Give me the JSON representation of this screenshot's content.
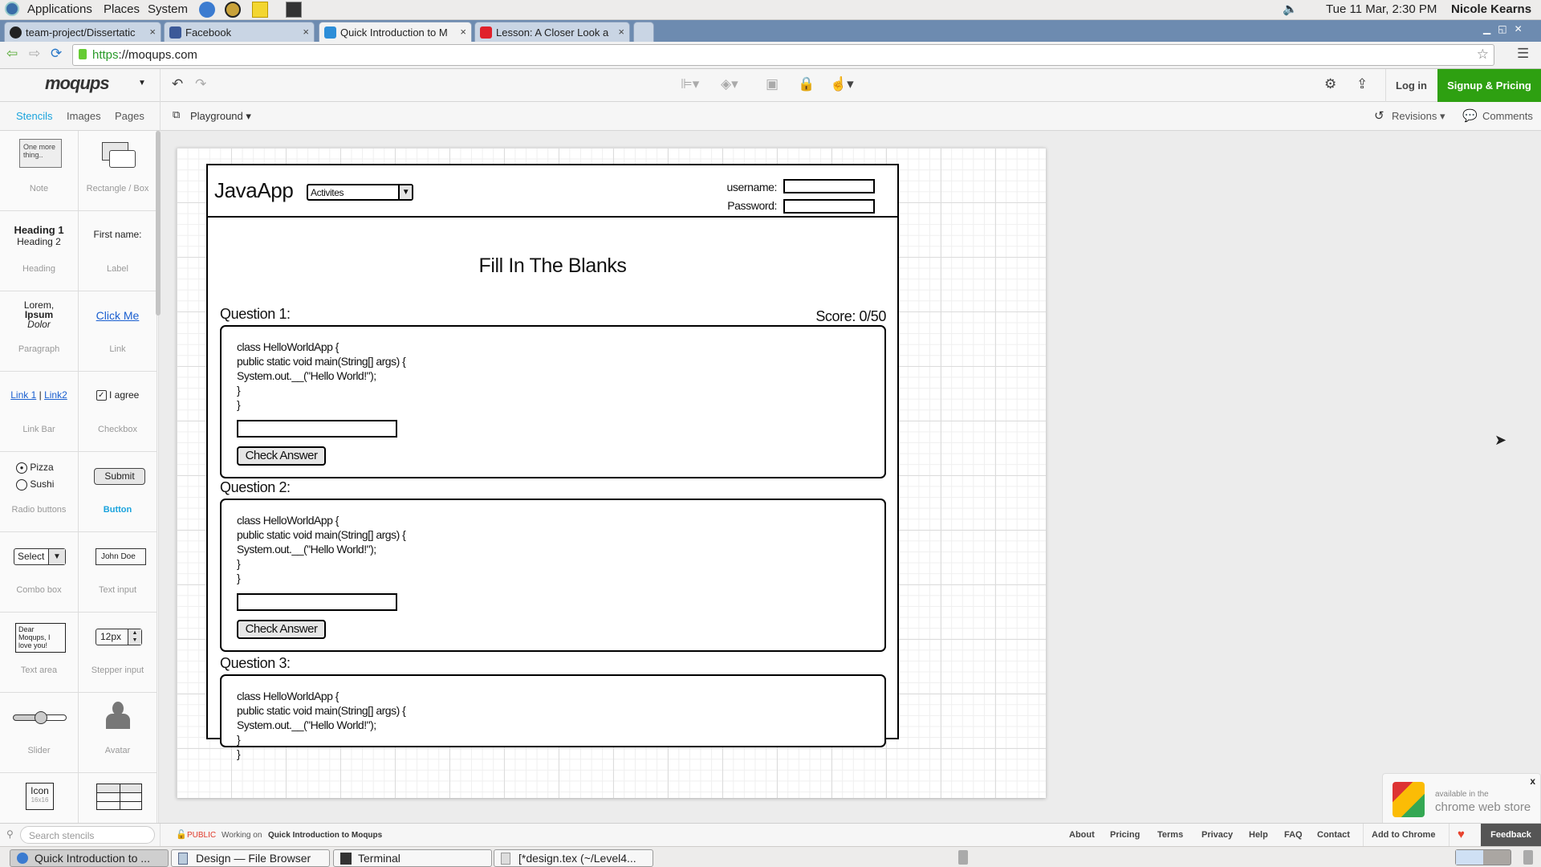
{
  "os_panel": {
    "menus": [
      "Applications",
      "Places",
      "System"
    ],
    "clock": "Tue 11 Mar,  2:30 PM",
    "user": "Nicole Kearns"
  },
  "browser": {
    "tabs": [
      {
        "title": "team-project/Dissertatic",
        "active": false
      },
      {
        "title": "Facebook",
        "active": false
      },
      {
        "title": "Quick Introduction to M",
        "active": true
      },
      {
        "title": "Lesson: A Closer Look a",
        "active": false
      }
    ],
    "url_scheme": "https",
    "url_rest": "://moqups.com"
  },
  "app": {
    "logo": "moqups",
    "login": "Log in",
    "signup": "Signup & Pricing",
    "side_tabs": [
      "Stencils",
      "Images",
      "Pages"
    ],
    "page_selector": "Playground",
    "revisions": "Revisions",
    "comments": "Comments",
    "search_placeholder": "Search stencils",
    "status": {
      "visibility": "PUBLIC",
      "working_on": "Working on",
      "project": "Quick Introduction to Moqups"
    },
    "footer_links": [
      "About",
      "Pricing",
      "Terms",
      "Privacy",
      "Help",
      "FAQ",
      "Contact",
      "Add to Chrome"
    ],
    "feedback": "Feedback",
    "chrome_store": {
      "line1": "available in the",
      "line2": "chrome web store"
    },
    "accent": "#1aa3dd",
    "signup_color": "#2ea011"
  },
  "stencils": {
    "note": {
      "label": "Note",
      "preview": "One more thing.."
    },
    "rect": {
      "label": "Rectangle / Box"
    },
    "heading": {
      "label": "Heading",
      "h1": "Heading 1",
      "h2": "Heading 2"
    },
    "label": {
      "label": "Label",
      "preview": "First name:"
    },
    "paragraph": {
      "label": "Paragraph",
      "l1": "Lorem,",
      "l2": "Ipsum",
      "l3": "Dolor"
    },
    "link": {
      "label": "Link",
      "preview": "Click Me"
    },
    "linkbar": {
      "label": "Link Bar",
      "l1": "Link 1",
      "sep": "|",
      "l2": "Link2"
    },
    "checkbox": {
      "label": "Checkbox",
      "preview": "I agree"
    },
    "radio": {
      "label": "Radio buttons",
      "o1": "Pizza",
      "o2": "Sushi"
    },
    "button": {
      "label": "Button",
      "preview": "Submit"
    },
    "combo": {
      "label": "Combo box",
      "preview": "Select"
    },
    "textinput": {
      "label": "Text input",
      "preview": "John Doe"
    },
    "textarea": {
      "label": "Text area",
      "preview": "Dear Moqups, I love you!"
    },
    "stepper": {
      "label": "Stepper input",
      "preview": "12px"
    },
    "slider": {
      "label": "Slider",
      "value": 0.55
    },
    "avatar": {
      "label": "Avatar"
    },
    "icon": {
      "preview": "Icon",
      "size": "16x16"
    }
  },
  "mockup": {
    "app_name": "JavaApp",
    "combo": "Activites",
    "username_label": "username:",
    "password_label": "Password:",
    "title": "Fill In The Blanks",
    "score": "Score: 0/50",
    "questions": [
      {
        "label": "Question 1:",
        "code": [
          "class HelloWorldApp {",
          "public static void main(String[] args) {",
          "System.out.__(\"Hello World!\");",
          "}",
          "}"
        ],
        "button": "Check Answer"
      },
      {
        "label": "Question 2:",
        "code": [
          "class HelloWorldApp {",
          "public static void main(String[] args) {",
          "System.out.__(\"Hello World!\");",
          "}",
          "}"
        ],
        "button": "Check Answer"
      },
      {
        "label": "Question 3:",
        "code": [
          "class HelloWorldApp {",
          "public static void main(String[] args) {",
          "System.out.__(\"Hello World!\");",
          "}",
          "}"
        ]
      }
    ]
  },
  "taskbar": [
    "Quick Introduction to ...",
    "Design — File Browser",
    "Terminal",
    "[*design.tex (~/Level4..."
  ]
}
